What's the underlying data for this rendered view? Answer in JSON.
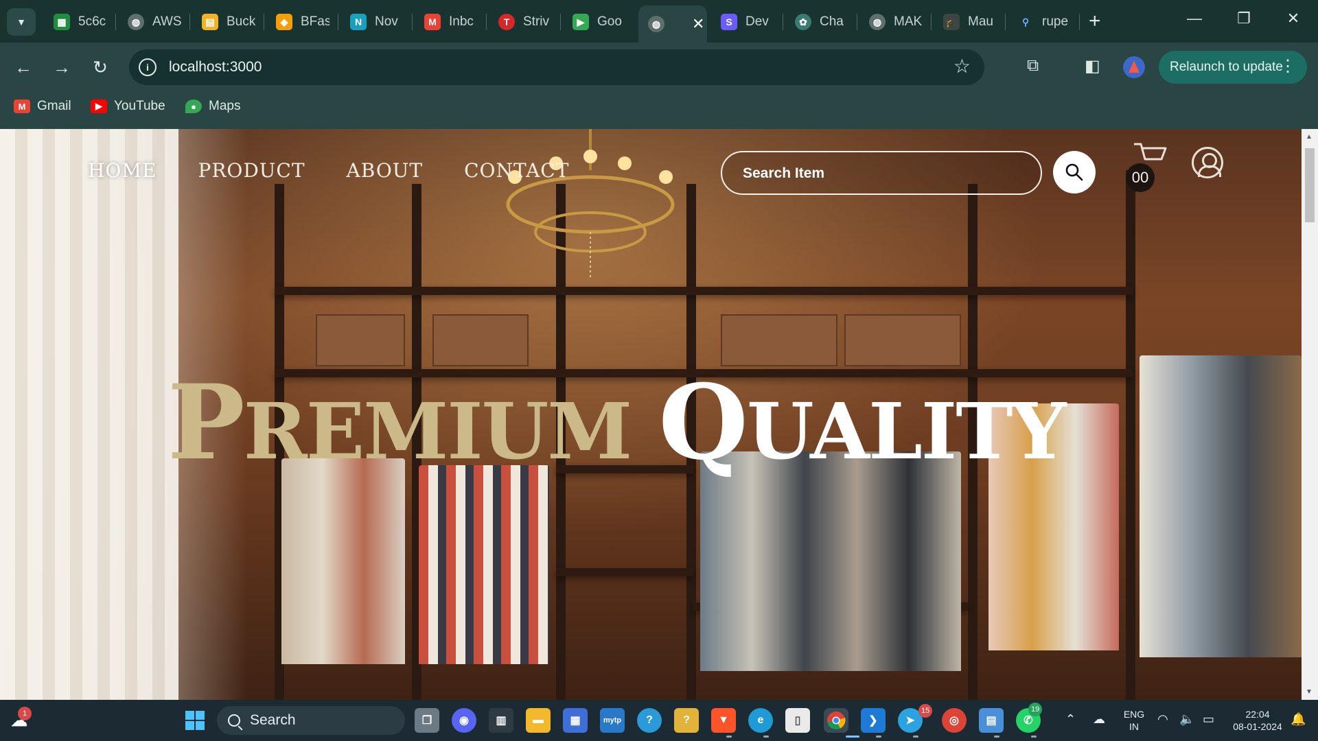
{
  "browser": {
    "tabs": [
      {
        "title": "5c6c",
        "icon": "sheets-icon",
        "color": "#1e8e3e"
      },
      {
        "title": "AWS",
        "icon": "globe-icon",
        "color": "#5f6f6d"
      },
      {
        "title": "Buck",
        "icon": "bucket-icon",
        "color": "#f0b429"
      },
      {
        "title": "BFas",
        "icon": "bfast-icon",
        "color": "#f59e0b"
      },
      {
        "title": "Nov",
        "icon": "n-icon",
        "color": "#1a9fbf"
      },
      {
        "title": "Inbc",
        "icon": "gmail-icon",
        "color": "#ea4335"
      },
      {
        "title": "Striv",
        "icon": "tuf-icon",
        "color": "#d62828"
      },
      {
        "title": "Goo",
        "icon": "meet-icon",
        "color": "#34a853"
      },
      {
        "title": "",
        "icon": "globe-icon",
        "color": "#5f6f6d",
        "active": true
      },
      {
        "title": "Dev",
        "icon": "s-icon",
        "color": "#6b5cff"
      },
      {
        "title": "Cha",
        "icon": "chatgpt-icon",
        "color": "#3a7a70"
      },
      {
        "title": "MAK",
        "icon": "globe-icon",
        "color": "#5f6f6d"
      },
      {
        "title": "Mau",
        "icon": "grad-cap-icon",
        "color": "#3a4644"
      },
      {
        "title": "rupe",
        "icon": "search-icon",
        "color": "#1a73e8"
      }
    ],
    "close_glyph": "✕",
    "new_tab_glyph": "+",
    "url": "localhost:3000",
    "relaunch_label": "Relaunch to update",
    "bookmarks": [
      {
        "label": "Gmail",
        "icon": "gmail-icon",
        "color": "#ea4335"
      },
      {
        "label": "YouTube",
        "icon": "youtube-icon",
        "color": "#ff0000"
      },
      {
        "label": "Maps",
        "icon": "maps-icon",
        "color": "#34a853"
      }
    ]
  },
  "site": {
    "nav": [
      "HOME",
      "PRODUCT",
      "ABOUT",
      "CONTACT"
    ],
    "search_placeholder": "Search Item",
    "cart_count": "00",
    "hero": {
      "word1_initial": "P",
      "word1_rest": "REMIUM",
      "word2_initial": "Q",
      "word2_rest": "UALITY"
    },
    "colors": {
      "hero_gold": "#cbb98a",
      "hero_white": "#ffffff"
    }
  },
  "taskbar": {
    "search_label": "Search",
    "language_line1": "ENG",
    "language_line2": "IN",
    "time": "22:04",
    "date": "08-01-2024",
    "weather_badge": "1",
    "telegram_badge": "15",
    "whatsapp_badge": "19"
  }
}
